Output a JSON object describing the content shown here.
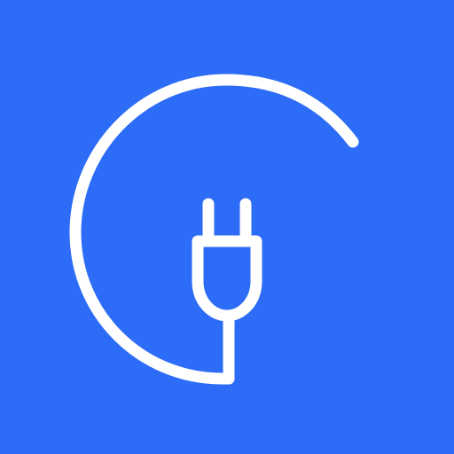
{
  "icon": {
    "name": "plug-logo-icon",
    "background_color": "#2D6CF6",
    "foreground_color": "#FFFFFF"
  }
}
